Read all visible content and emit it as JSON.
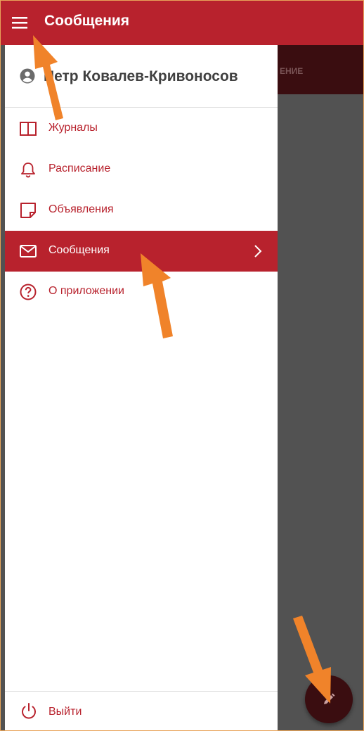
{
  "topbar": {
    "title": "Сообщения",
    "menu_icon": "menu-icon"
  },
  "behind": {
    "tab_fragment": "ЕНИЕ"
  },
  "drawer": {
    "user_name": "Петр Ковалев-Кривоносов",
    "items": [
      {
        "label": "Журналы",
        "icon": "book-icon"
      },
      {
        "label": "Расписание",
        "icon": "bell-icon"
      },
      {
        "label": "Объявления",
        "icon": "note-icon"
      },
      {
        "label": "Сообщения",
        "icon": "mail-icon",
        "active": true
      },
      {
        "label": "О приложении",
        "icon": "help-icon"
      }
    ],
    "logout_label": "Выйти"
  },
  "colors": {
    "brand": "#b8222d",
    "scrim": "#525252",
    "fab": "#3a0d10",
    "annotation": "#f0832a"
  }
}
